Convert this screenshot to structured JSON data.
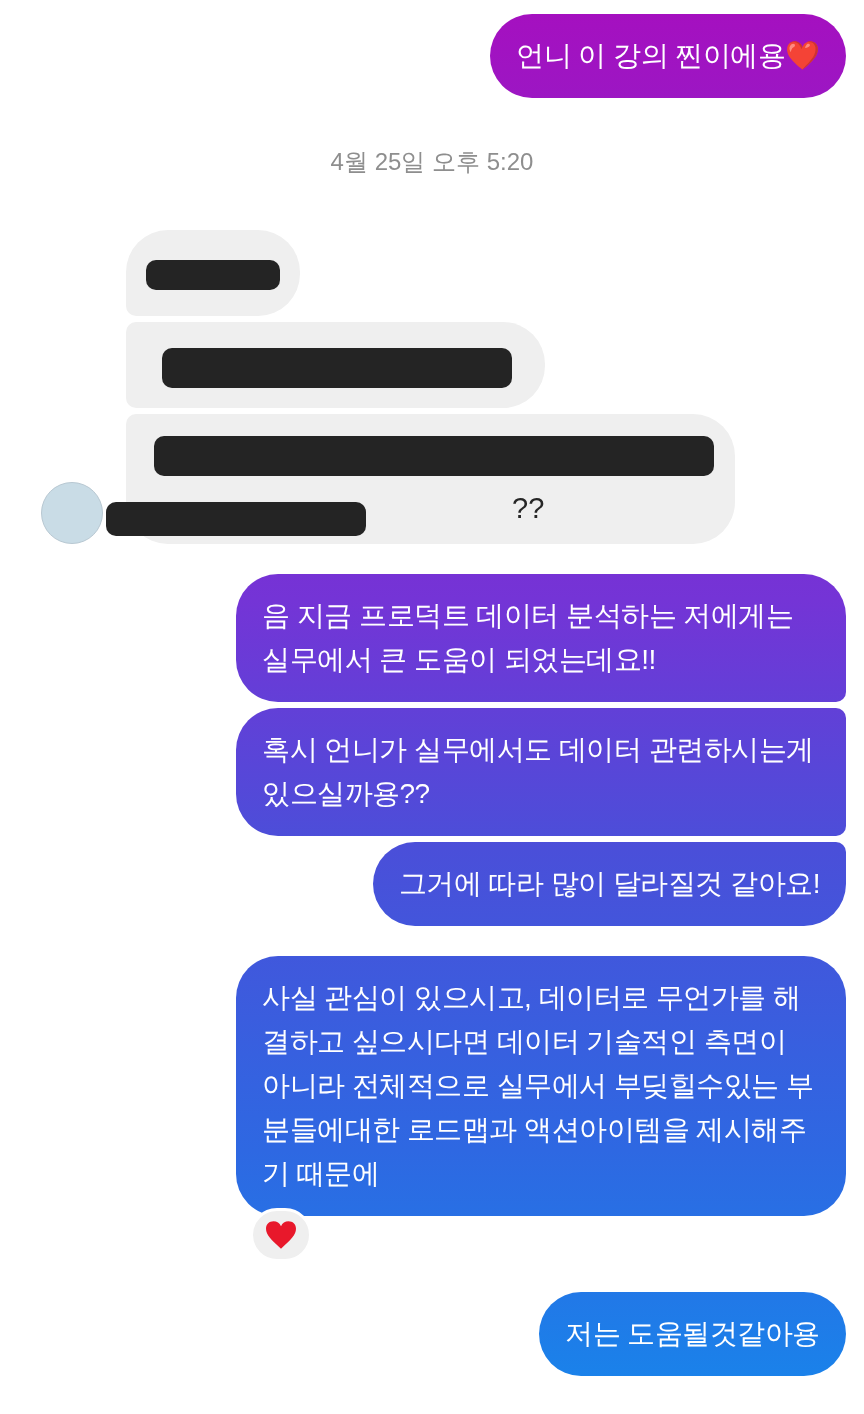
{
  "messages": [
    {
      "kind": "outgoing",
      "joined_to_previous": false,
      "text": "언니 이 강의 찐이에용❤️"
    },
    {
      "kind": "timestamp",
      "text": "4월 25일 오후 5:20"
    },
    {
      "kind": "redacted_short",
      "joined_to_previous": false
    },
    {
      "kind": "redacted_medium",
      "joined_to_previous": true
    },
    {
      "kind": "redacted_long",
      "joined_to_previous": true,
      "visible_text": "??",
      "avatar": true
    },
    {
      "kind": "outgoing",
      "joined_to_previous": false,
      "text": "음 지금 프로덕트 데이터 분석하는 저에게는 실무에서 큰 도움이 되었는데요!!"
    },
    {
      "kind": "outgoing",
      "joined_to_previous": true,
      "text": "혹시 언니가 실무에서도 데이터 관련하시는게 있으실까용??"
    },
    {
      "kind": "outgoing",
      "joined_to_previous": true,
      "text": "그거에 따라 많이 달라질것 같아요!"
    },
    {
      "kind": "outgoing",
      "joined_to_previous": false,
      "text": "사실 관심이 있으시고, 데이터로 무언가를 해결하고 싶으시다면 데이터 기술적인 측면이 아니라 전체적으로 실무에서 부딪힐수있는 부분들에대한 로드맵과 액션아이템을 제시해주기 때문에",
      "reacted": true
    },
    {
      "kind": "outgoing",
      "joined_to_previous": false,
      "text": "저는 도움될것같아용"
    }
  ]
}
